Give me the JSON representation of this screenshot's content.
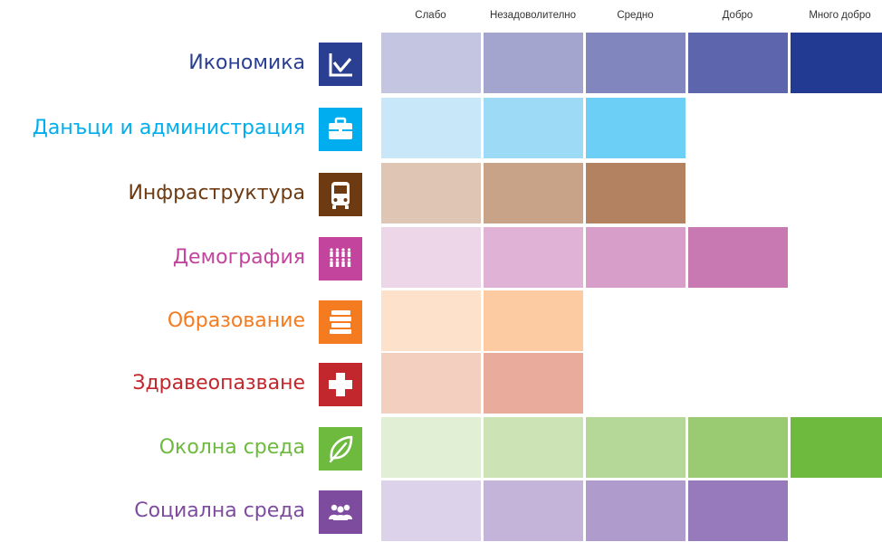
{
  "chart_data": {
    "type": "heatmap",
    "columns": [
      "Слабо",
      "Незадоволително",
      "Средно",
      "Добро",
      "Много добро"
    ],
    "rows": [
      {
        "label": "Икономика",
        "icon": "chart-line-icon",
        "color": "#2a3f92",
        "level": 5,
        "cell_colors": [
          "#c4c5e1",
          "#a3a5cf",
          "#8286bf",
          "#5d65ad",
          "#233a92"
        ]
      },
      {
        "label": "Данъци и администрация",
        "icon": "briefcase-icon",
        "color": "#00aeef",
        "level": 3,
        "cell_colors": [
          "#c8e8f9",
          "#9cdaf6",
          "#6ccff5"
        ]
      },
      {
        "label": "Инфраструктура",
        "icon": "bus-icon",
        "color": "#6d3a12",
        "level": 3,
        "cell_colors": [
          "#dfc5b3",
          "#c9a387",
          "#b38261"
        ]
      },
      {
        "label": "Демография",
        "icon": "people-icon",
        "color": "#c2449c",
        "level": 4,
        "cell_colors": [
          "#ecd6e8",
          "#e0b3d6",
          "#d69ec8",
          "#c879b2"
        ]
      },
      {
        "label": "Образование",
        "icon": "books-icon",
        "color": "#f47b20",
        "level": 2,
        "cell_colors": [
          "#fde1ca",
          "#fccba2"
        ]
      },
      {
        "label": "Здравеопазване",
        "icon": "medical-cross-icon",
        "color": "#c1272d",
        "level": 2,
        "cell_colors": [
          "#f3cfbf",
          "#e8ab9c"
        ]
      },
      {
        "label": "Околна среда",
        "icon": "leaf-icon",
        "color": "#6dba3f",
        "level": 5,
        "cell_colors": [
          "#e1efd4",
          "#cbe3b5",
          "#b5d797",
          "#9acb72",
          "#6dba3f"
        ]
      },
      {
        "label": "Социална среда",
        "icon": "group-icon",
        "color": "#7e4c9f",
        "level": 4,
        "cell_colors": [
          "#dcd2ea",
          "#c4b4d9",
          "#b09ccc",
          "#977abb"
        ]
      }
    ]
  }
}
